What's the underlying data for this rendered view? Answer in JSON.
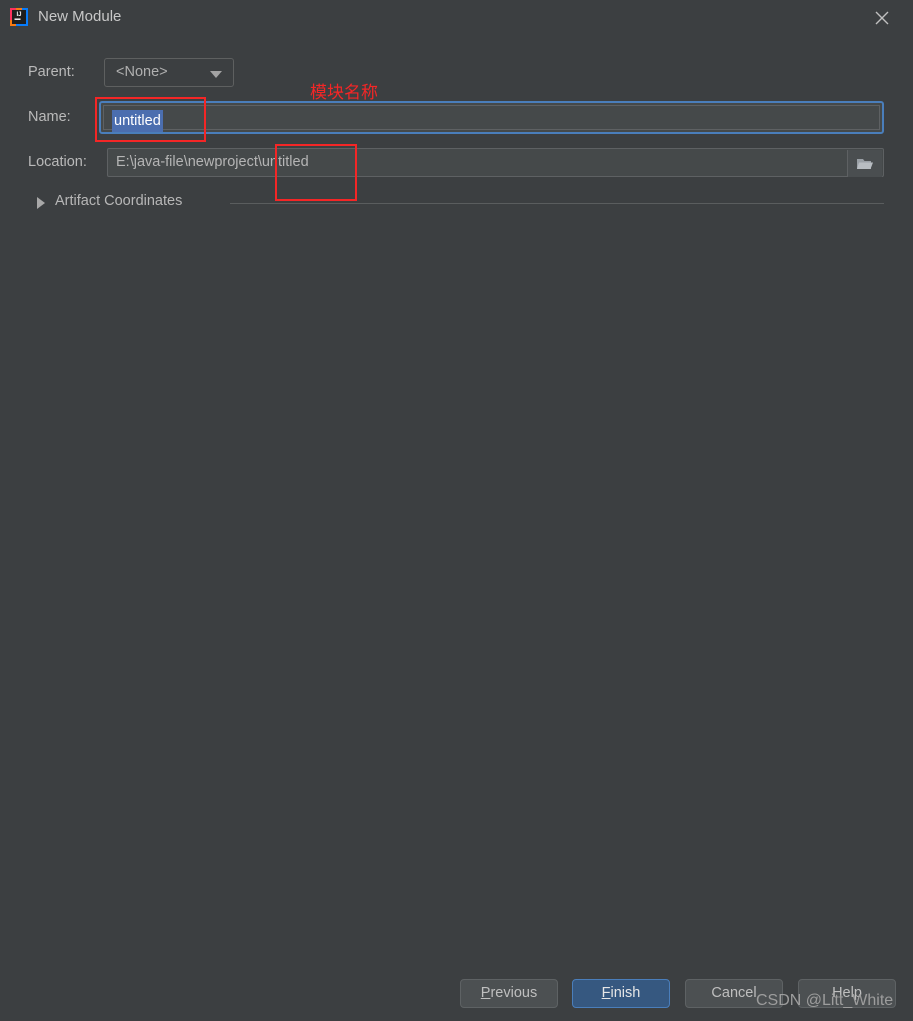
{
  "window": {
    "title": "New Module",
    "app_icon": "intellij-idea-icon",
    "close_icon": "close-icon",
    "background_color": "#3c3f41"
  },
  "form": {
    "parent": {
      "label": "Parent:",
      "value": "<None>",
      "dropdown_icon": "chevron-down-icon"
    },
    "name": {
      "label": "Name:",
      "value": "untitled",
      "selected": true,
      "focus_color": "#4a7ebb",
      "selection_color": "#4b6eaf"
    },
    "location": {
      "label": "Location:",
      "value": "E:\\java-file\\newproject\\untitled",
      "browse_icon": "folder-icon"
    },
    "artifact_coordinates": {
      "label": "Artifact Coordinates",
      "expanded": false,
      "arrow_icon": "chevron-right-icon"
    }
  },
  "annotations": {
    "module_name_text": "模块名称",
    "color": "#f42626"
  },
  "buttons": {
    "previous": {
      "prefix": "P",
      "rest": "revious"
    },
    "finish": {
      "prefix": "F",
      "rest": "inish"
    },
    "cancel": {
      "label": "Cancel"
    },
    "help": {
      "label": "Help"
    },
    "finish_color": "#365880"
  },
  "watermark": {
    "text": "CSDN @Litt_White"
  }
}
